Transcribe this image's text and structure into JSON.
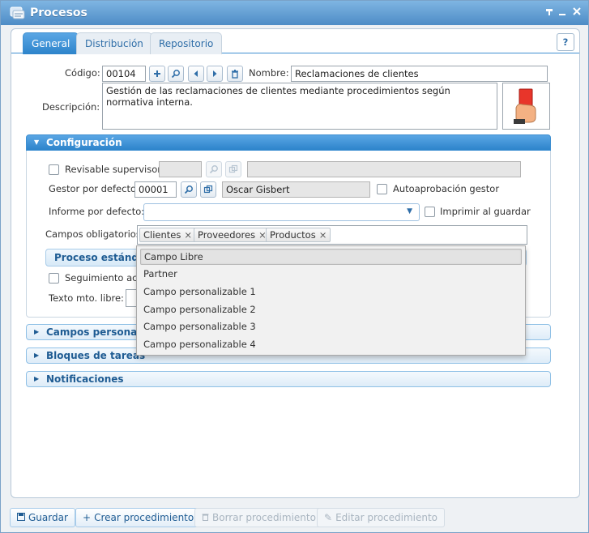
{
  "window": {
    "title": "Procesos"
  },
  "tabs": [
    {
      "label": "General",
      "active": true
    },
    {
      "label": "Distribución",
      "active": false
    },
    {
      "label": "Repositorio",
      "active": false
    }
  ],
  "help": "?",
  "header": {
    "codigo_label": "Código:",
    "codigo_value": "00104",
    "nombre_label": "Nombre:",
    "nombre_value": "Reclamaciones de clientes",
    "descripcion_label": "Descripción:",
    "descripcion_value": "Gestión de las reclamaciones de clientes mediante procedimientos según normativa interna."
  },
  "config": {
    "title": "Configuración",
    "revisable_label": "Revisable supervisor",
    "gestor_label": "Gestor por defecto",
    "gestor_code": "00001",
    "gestor_name": "Oscar Gisbert",
    "autoaprobacion_label": "Autoaprobación gestor",
    "informe_label": "Informe por defecto:",
    "imprimir_label": "Imprimir al guardar",
    "campos_label": "Campos obligatorios:",
    "campos_tags": [
      "Clientes",
      "Proveedores",
      "Productos"
    ],
    "proceso_estandar": "Proceso estándar",
    "seguimiento_label": "Seguimiento acti",
    "texto_label": "Texto mto. libre:"
  },
  "dropdown": {
    "items": [
      "Campo Libre",
      "Partner",
      "Campo personalizable 1",
      "Campo personalizable 2",
      "Campo personalizable 3",
      "Campo personalizable 4"
    ]
  },
  "sections": {
    "campos_personalizados": "Campos personaliza",
    "bloques": "Bloques de tareas",
    "notificaciones": "Notificaciones"
  },
  "footer": {
    "guardar": "Guardar",
    "crear": "Crear procedimiento",
    "borrar": "Borrar procedimiento",
    "editar": "Editar procedimiento"
  },
  "colors": {
    "accent": "#3e8fd1",
    "title_bar": "#4d8cc6",
    "section_text": "#1f5c93"
  }
}
